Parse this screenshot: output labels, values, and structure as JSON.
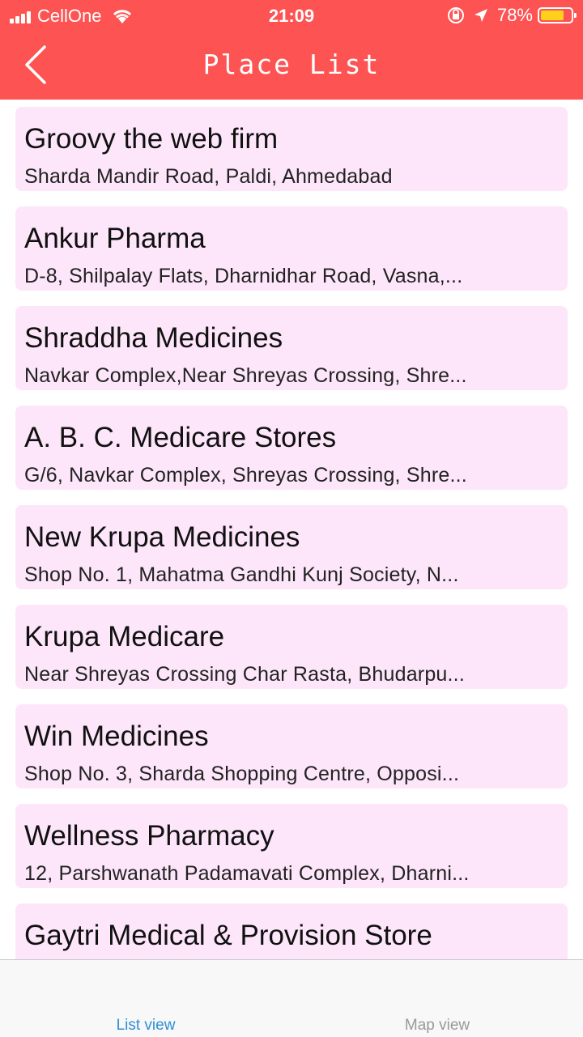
{
  "status_bar": {
    "carrier": "CellOne",
    "time": "21:09",
    "battery_percent": "78%",
    "battery_level": 0.78,
    "icons": [
      "signal-icon",
      "wifi-icon",
      "orientation-lock-icon",
      "location-arrow-icon",
      "battery-icon"
    ]
  },
  "header": {
    "title": "Place List",
    "back_icon": "chevron-left-icon",
    "background_color": "#fd5353"
  },
  "places": [
    {
      "name": "Groovy the web firm",
      "address": "Sharda Mandir Road, Paldi, Ahmedabad"
    },
    {
      "name": "Ankur Pharma",
      "address": "D-8, Shilpalay Flats, Dharnidhar Road, Vasna,..."
    },
    {
      "name": "Shraddha Medicines",
      "address": "Navkar Complex,Near Shreyas Crossing, Shre..."
    },
    {
      "name": "A. B. C. Medicare Stores",
      "address": "G/6, Navkar Complex, Shreyas Crossing, Shre..."
    },
    {
      "name": "New Krupa Medicines",
      "address": "Shop No. 1, Mahatma Gandhi Kunj Society, N..."
    },
    {
      "name": "Krupa Medicare",
      "address": "Near Shreyas Crossing Char Rasta, Bhudarpu..."
    },
    {
      "name": "Win Medicines",
      "address": "Shop No. 3, Sharda Shopping Centre, Opposi..."
    },
    {
      "name": "Wellness Pharmacy",
      "address": "12, Parshwanath Padamavati Complex, Dharni..."
    },
    {
      "name": "Gaytri Medical & Provision Store",
      "address": ""
    }
  ],
  "card_color": "#fde6fa",
  "tabbar": {
    "tabs": [
      {
        "label": "List view",
        "active": true,
        "color": "#2d8fd5"
      },
      {
        "label": "Map view",
        "active": false,
        "color": "#999999"
      }
    ]
  }
}
